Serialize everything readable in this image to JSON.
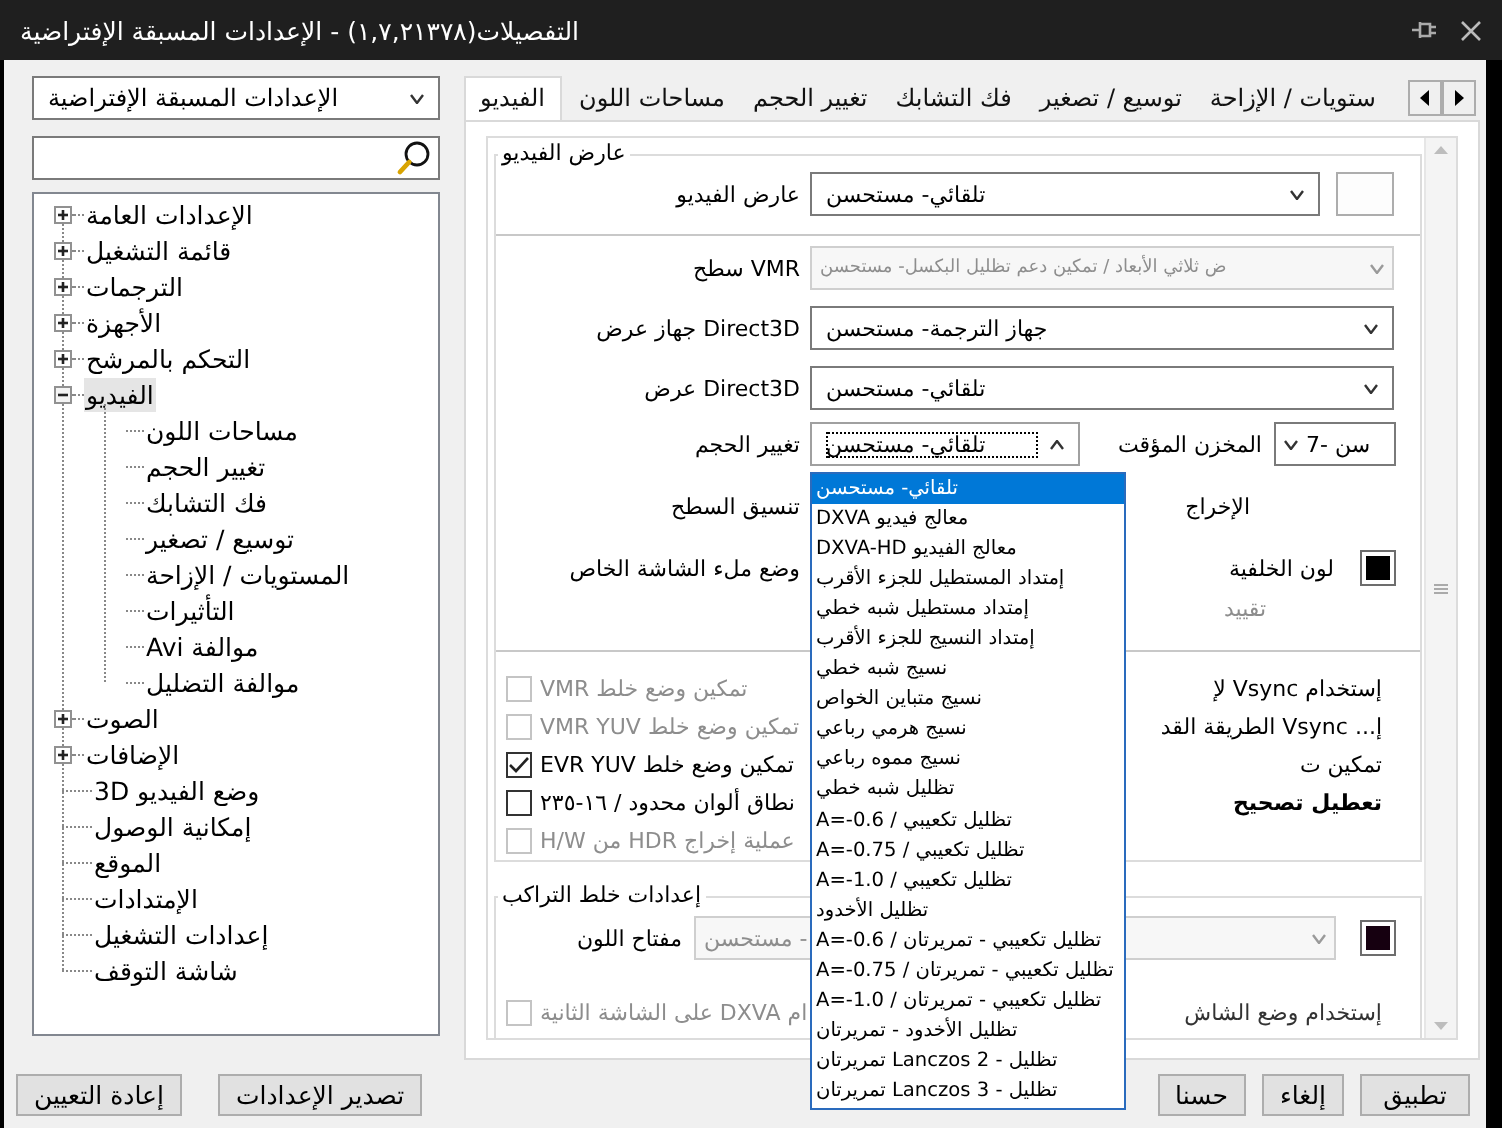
{
  "window": {
    "title": "التفصيلات(١,٧,٢١٣٧٨) - الإعدادات المسبقة الإفتراضية"
  },
  "sidebar": {
    "preset": {
      "value": "الإعدادات المسبقة الإفتراضية",
      "open": false
    },
    "tree": [
      {
        "label": "الإعدادات العامة",
        "kind": "group",
        "expanded": false,
        "selected": false
      },
      {
        "label": "قائمة التشغيل",
        "kind": "group",
        "expanded": false,
        "selected": false
      },
      {
        "label": "الترجمات",
        "kind": "group",
        "expanded": false,
        "selected": false
      },
      {
        "label": "الأجهزة",
        "kind": "group",
        "expanded": false,
        "selected": false
      },
      {
        "label": "التحكم بالمرشح",
        "kind": "group",
        "expanded": false,
        "selected": false
      },
      {
        "label": "الفيديو",
        "kind": "group",
        "expanded": true,
        "selected": true,
        "children": [
          {
            "label": "مساحات اللون",
            "selected": false
          },
          {
            "label": "تغيير الحجم",
            "selected": false
          },
          {
            "label": "فك التشابك",
            "selected": false
          },
          {
            "label": "توسيع / تصغير",
            "selected": false
          },
          {
            "label": "المستويات / الإزاحة",
            "selected": false
          },
          {
            "label": "التأثيرات",
            "selected": false
          },
          {
            "label": "موالفة Avi",
            "selected": false
          },
          {
            "label": "موالفة التضليل",
            "selected": false
          }
        ]
      },
      {
        "label": "الصوت",
        "kind": "group",
        "expanded": false,
        "selected": false
      },
      {
        "label": "الإضافات",
        "kind": "group",
        "expanded": false,
        "selected": false
      },
      {
        "label": "وضع الفيديو 3D",
        "kind": "page",
        "selected": false
      },
      {
        "label": "إمكانية الوصول",
        "kind": "page",
        "selected": false
      },
      {
        "label": "الموقع",
        "kind": "page",
        "selected": false
      },
      {
        "label": "الإمتدادات",
        "kind": "page",
        "selected": false
      },
      {
        "label": "إعدادات التشغيل",
        "kind": "page",
        "selected": false
      },
      {
        "label": "شاشة التوقف",
        "kind": "page",
        "selected": false
      }
    ]
  },
  "tabs": [
    {
      "label": "ستويات / الإزاحة",
      "selected": false
    },
    {
      "label": "توسيع / تصغير",
      "selected": false
    },
    {
      "label": "فك التشابك",
      "selected": false
    },
    {
      "label": "تغيير الحجم",
      "selected": false
    },
    {
      "label": "مساحات اللون",
      "selected": false
    },
    {
      "label": "الفيديو",
      "selected": true
    }
  ],
  "renderer_group": {
    "title": "عارض الفيديو",
    "renderer": {
      "label": "عارض الفيديو",
      "value": "تلقائي- مستحسن",
      "open": false,
      "disabled": false
    },
    "vmr_surface": {
      "label": "سطح VMR",
      "value": "ض ثلاثي الأبعاد / تمكين دعم تظليل البكسل- مستحسن",
      "open": false,
      "disabled": true
    },
    "d3d_device": {
      "label": "جهاز عرض Direct3D",
      "value": "جهاز الترجمة- مستحسن",
      "open": false,
      "disabled": false
    },
    "d3d_renderer": {
      "label": "عرض Direct3D",
      "value": "تلقائي- مستحسن",
      "open": false,
      "disabled": false
    },
    "resize": {
      "label": "تغيير الحجم",
      "value": "تلقائي- مستحسن",
      "open": true,
      "disabled": false
    },
    "buffer": {
      "label": "المخزن المؤقت",
      "value": "سن -7",
      "open": false,
      "disabled": false
    },
    "surface_format": {
      "label": "تنسيق السطح"
    },
    "output": {
      "label": "الإخراج"
    },
    "fullscreen_mode": {
      "label": "وضع ملء الشاشة الخاص"
    },
    "background_color": {
      "label": "لون الخلفية",
      "color": "#000000"
    },
    "limit": {
      "label": "تقييد",
      "disabled": true
    },
    "checks": [
      {
        "label": "تمكين وضع خلط VMR",
        "checked": false,
        "disabled": true
      },
      {
        "label": "تمكين وضع خلط VMR YUV",
        "checked": false,
        "disabled": true
      },
      {
        "label": "تمكين وضع خلط EVR YUV",
        "checked": true,
        "disabled": false
      },
      {
        "label": "نطاق ألوان محدود / ١٦-٢٣٥",
        "checked": false,
        "disabled": false
      },
      {
        "label": "عملية إخراج HDR من H/W",
        "checked": false,
        "disabled": true
      }
    ],
    "options": [
      {
        "label": "إستخدام Vsync لإ",
        "bold": false
      },
      {
        "label": "إ... Vsync الطريقة القد",
        "bold": false
      },
      {
        "label": "تمكين ت",
        "bold": false
      },
      {
        "label": "تعطيل تصحيح",
        "bold": true
      }
    ]
  },
  "overlay_group": {
    "title": "إعدادات خلط التراكب",
    "color_key": {
      "label": "مفتاح اللون",
      "value": "- مستحسن",
      "open": false,
      "disabled": true,
      "color": "#160010"
    },
    "second_screen": {
      "label_start": "إستخدام وضع الشاش",
      "label_end": "ام DXVA على الشاشة الثانية",
      "checked": false,
      "disabled": true
    }
  },
  "resize_options": [
    {
      "label": "تلقائي- مستحسن",
      "selected": true
    },
    {
      "label": "معالج فيديو DXVA",
      "selected": false
    },
    {
      "label": "معالج الفيديو DXVA-HD",
      "selected": false
    },
    {
      "label": "إمتداد المستطيل للجزء الأقرب",
      "selected": false
    },
    {
      "label": "إمتداد مستطيل شبه خطي",
      "selected": false
    },
    {
      "label": "إمتداد النسيج للجزء الأقرب",
      "selected": false
    },
    {
      "label": "نسيج شبه خطي",
      "selected": false
    },
    {
      "label": "نسيج متباين الخواص",
      "selected": false
    },
    {
      "label": "نسيج هرمي رباعي",
      "selected": false
    },
    {
      "label": "نسيج مموه رباعي",
      "selected": false
    },
    {
      "label": "تظليل شبه خطي",
      "selected": false
    },
    {
      "label": "تظليل تكعيبي / A=-0.6",
      "selected": false
    },
    {
      "label": "تظليل تكعيبي / A=-0.75",
      "selected": false
    },
    {
      "label": "تظليل تكعيبي / A=-1.0",
      "selected": false
    },
    {
      "label": "تظليل الأخدود",
      "selected": false
    },
    {
      "label": "تظليل تكعيبي - تمريرتان / A=-0.6",
      "selected": false
    },
    {
      "label": "تظليل تكعيبي - تمريرتان / A=-0.75",
      "selected": false
    },
    {
      "label": "تظليل تكعيبي - تمريرتان / A=-1.0",
      "selected": false
    },
    {
      "label": "تظليل الأخدود - تمريرتان",
      "selected": false
    },
    {
      "label": "تظليل - Lanczos 2 تمريرتان",
      "selected": false
    },
    {
      "label": "تظليل - Lanczos 3 تمريرتان",
      "selected": false
    }
  ],
  "buttons": {
    "left": [
      "تصدير الإعدادات",
      "إعادة التعيين"
    ],
    "right": [
      "تطبيق",
      "إلغاء",
      "حسنا"
    ]
  }
}
